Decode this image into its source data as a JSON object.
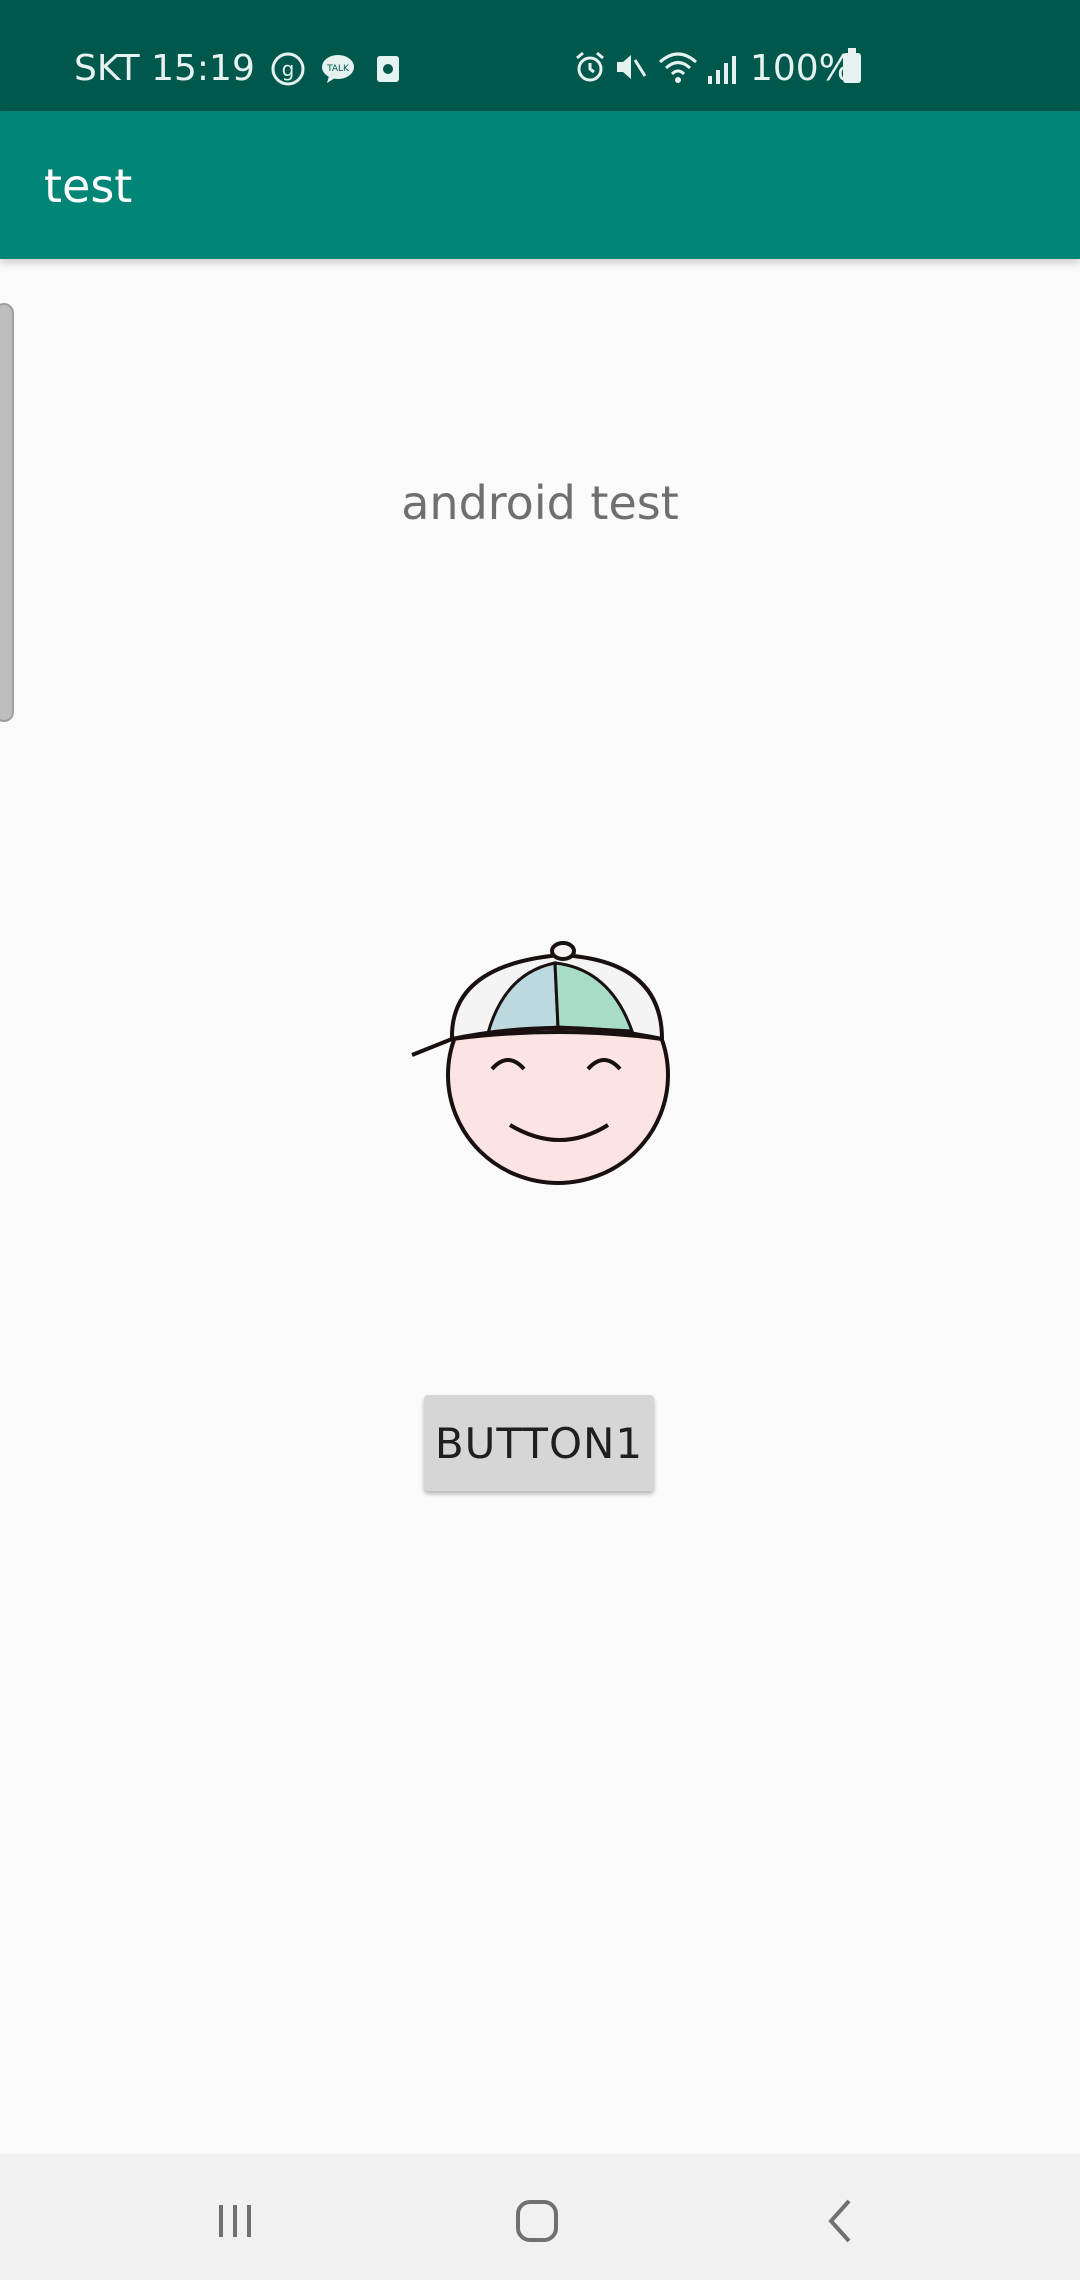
{
  "status_bar": {
    "carrier_time": "SKT 15:19",
    "battery_text": "100%",
    "icons": [
      "g-icon",
      "talk-icon",
      "screen-recorder-icon",
      "alarm-icon",
      "mute-icon",
      "wifi-icon",
      "signal-icon",
      "battery-icon"
    ]
  },
  "app_bar": {
    "title": "test"
  },
  "main": {
    "text": "android test",
    "image": "cap-boy-face-icon",
    "button_label": "BUTTON1"
  },
  "nav_bar": {
    "icons": [
      "recent-apps-icon",
      "home-icon",
      "back-icon"
    ]
  },
  "colors": {
    "status_bar": "#00574b",
    "app_bar": "#008577",
    "background": "#fafafa",
    "button": "#d6d6d6",
    "nav_bar": "#f1f1f1"
  }
}
